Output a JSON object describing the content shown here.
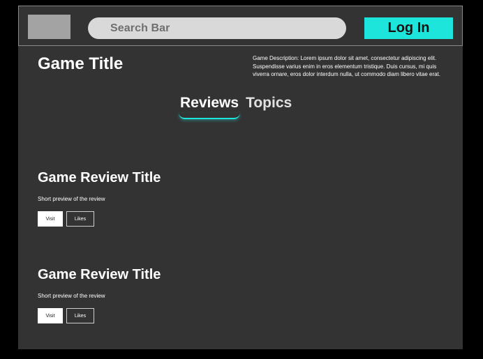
{
  "header": {
    "search_label": "Search Bar",
    "login_label": "Log In"
  },
  "game": {
    "title": "Game Title",
    "description": "Game Description: Lorem ipsum dolor sit amet, consectetur adipiscing elit. Suspendisse varius enim in eros elementum tristique. Duis cursus, mi quis viverra ornare, eros dolor interdum nulla, ut commodo diam libero vitae erat."
  },
  "tabs": [
    {
      "label": "Reviews",
      "active": true
    },
    {
      "label": "Topics",
      "active": false
    }
  ],
  "reviews": [
    {
      "title": "Game Review Title",
      "preview": "Short preview of the review",
      "visit_label": "Visit",
      "likes_label": "Likes"
    },
    {
      "title": "Game Review Title",
      "preview": "Short preview of the review",
      "visit_label": "Visit",
      "likes_label": "Likes"
    }
  ],
  "colors": {
    "accent": "#1de5dc",
    "background": "#333333",
    "page": "#000000"
  }
}
